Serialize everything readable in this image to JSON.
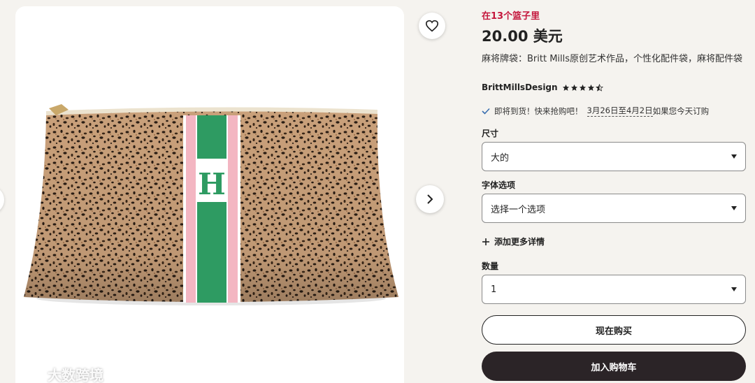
{
  "gallery": {
    "image_alt": "Leopard print zip pouch with green and pink stripe monogram H",
    "monogram": "H",
    "watermark_text": "大数跨境",
    "icons": [
      "heart-icon",
      "chevron-right-icon",
      "chevron-left-icon"
    ]
  },
  "product": {
    "basket_note": "在13个篮子里",
    "price": "20.00 美元",
    "title": "麻将牌袋：Britt Mills原创艺术作品，个性化配件袋，麻将配件袋",
    "shop_name": "BrittMillsDesign",
    "rating_stars": 4.5,
    "delivery_prefix": "即将到货！快来抢购吧！",
    "delivery_dates": "3月26日至4月2日",
    "delivery_suffix": "如果您今天订购"
  },
  "options": {
    "size_label": "尺寸",
    "size_value": "大的",
    "font_label": "字体选项",
    "font_value": "选择一个选项",
    "add_details": "添加更多详情",
    "quantity_label": "数量",
    "quantity_value": "1"
  },
  "actions": {
    "buy_now": "现在购买",
    "add_to_cart": "加入购物车"
  },
  "colors": {
    "accent_red": "#c4163c",
    "button_dark": "#2b2427",
    "stripe_green": "#2e9b62",
    "stripe_pink": "#f3b6c2"
  }
}
